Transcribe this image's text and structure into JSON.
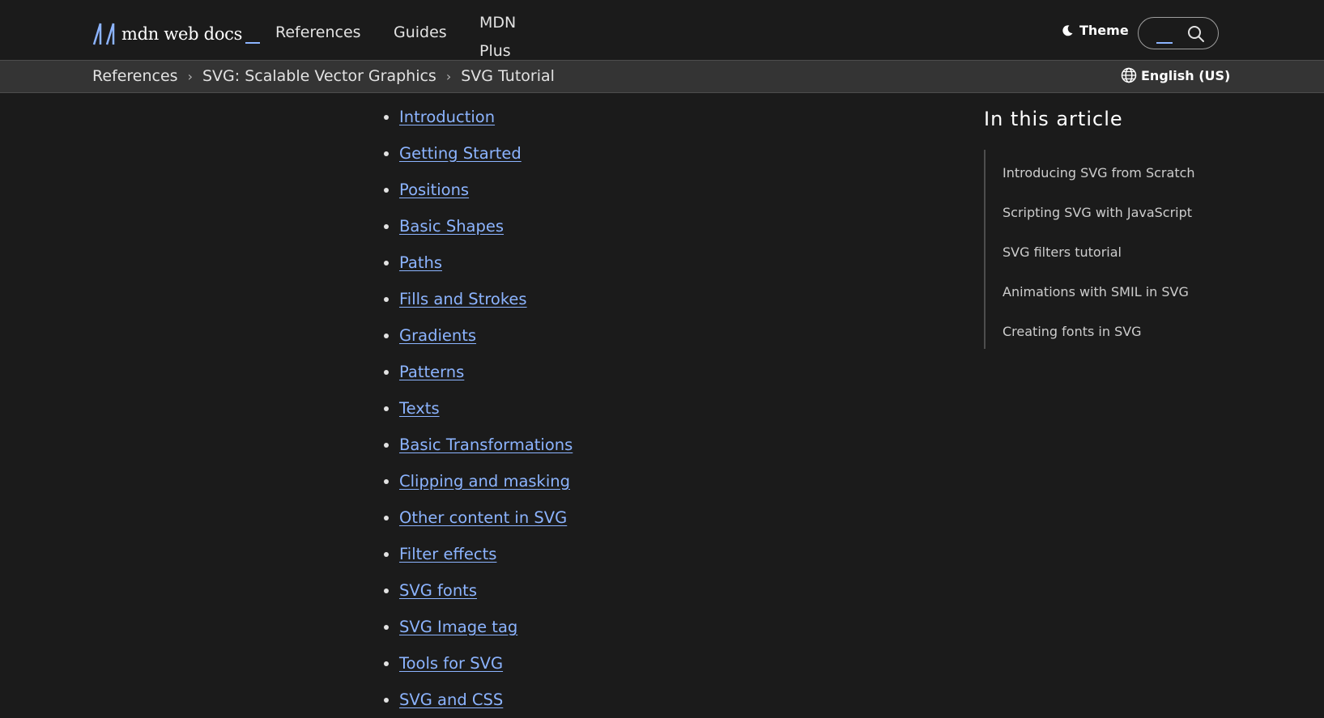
{
  "header": {
    "logo_text": "mdn web docs",
    "nav": {
      "references": "References",
      "guides": "Guides",
      "plus_line1": "MDN",
      "plus_line2": "Plus"
    },
    "theme_label": "Theme"
  },
  "breadcrumb": {
    "items": [
      "References",
      "SVG: Scalable Vector Graphics",
      "SVG Tutorial"
    ],
    "separator": "›"
  },
  "language": "English (US)",
  "tutorial_links": [
    "Introduction",
    "Getting Started",
    "Positions",
    "Basic Shapes",
    "Paths",
    "Fills and Strokes",
    "Gradients",
    "Patterns",
    "Texts",
    "Basic Transformations",
    "Clipping and masking",
    "Other content in SVG",
    "Filter effects",
    "SVG fonts",
    "SVG Image tag",
    "Tools for SVG",
    "SVG and CSS"
  ],
  "sidebar": {
    "title": "In this article",
    "links": [
      "Introducing SVG from Scratch",
      "Scripting SVG with JavaScript",
      "SVG filters tutorial",
      "Animations with SMIL in SVG",
      "Creating fonts in SVG"
    ]
  },
  "colors": {
    "background": "#1b1b1b",
    "link": "#8cb4ff",
    "breadcrumb_bg": "#343434"
  },
  "icons": {
    "logo": "mdn-logo-icon",
    "theme": "moon-icon",
    "search": "search-icon",
    "language": "globe-icon"
  }
}
